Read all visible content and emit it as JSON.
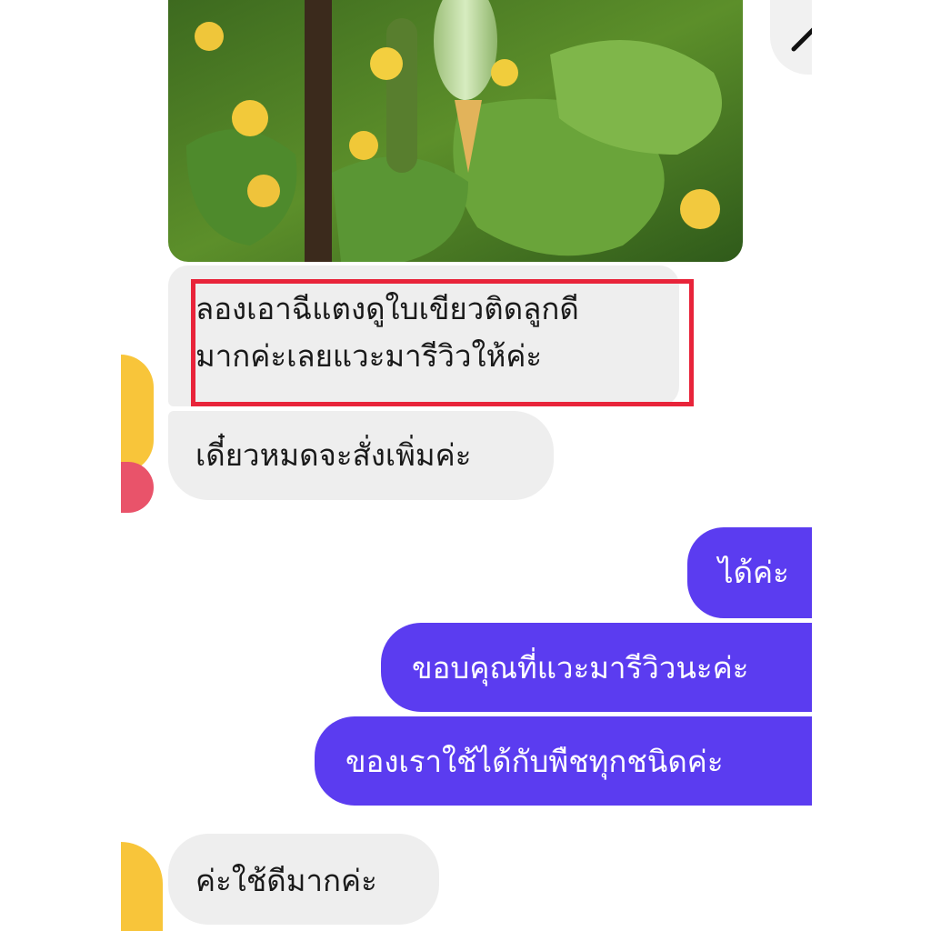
{
  "messages": [
    {
      "id": "m1",
      "direction": "incoming",
      "text_line1": "ลองเอาฉีแตงดูใบเขียวติดลูกดี",
      "text_line2": "มากค่ะเลยแวะมารีวิวให้ค่ะ"
    },
    {
      "id": "m2",
      "direction": "incoming",
      "text": "เดี๋ยวหมดจะสั่งเพิ่มค่ะ"
    },
    {
      "id": "m3",
      "direction": "outgoing",
      "text": "ได้ค่ะ"
    },
    {
      "id": "m4",
      "direction": "outgoing",
      "text": "ขอบคุณที่แวะมารีวิวนะค่ะ"
    },
    {
      "id": "m5",
      "direction": "outgoing",
      "text": "ของเราใช้ได้กับพืชทุกชนิดค่ะ"
    },
    {
      "id": "m6",
      "direction": "incoming",
      "text": "ค่ะใช้ดีมากค่ะ"
    }
  ],
  "colors": {
    "incoming_bubble": "#eeeeee",
    "outgoing_bubble": "#5b3cf0",
    "highlight_border": "#e8243a",
    "avatar": "#f8c53a",
    "heart": "#e9536a"
  },
  "icons": {
    "photo": "cucumber-plant-photo",
    "share": "share-icon",
    "avatar": "user-avatar"
  }
}
